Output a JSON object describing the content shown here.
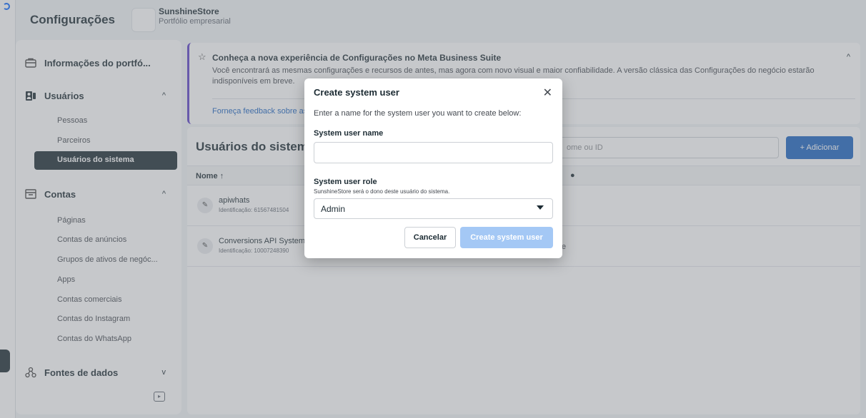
{
  "header": {
    "title": "Configurações",
    "store_name": "SunshineStore",
    "store_subtitle": "Portfólio empresarial"
  },
  "sidebar": {
    "sections": [
      {
        "label": "Informações do portfó...",
        "icon": "briefcase-icon"
      },
      {
        "label": "Usuários",
        "icon": "people-icon",
        "chevron": "^"
      },
      {
        "label": "Contas",
        "icon": "folder-icon",
        "chevron": "^"
      },
      {
        "label": "Fontes de dados",
        "icon": "data-sources-icon",
        "chevron": "v"
      }
    ],
    "user_items": [
      "Pessoas",
      "Parceiros",
      "Usuários do sistema"
    ],
    "account_items": [
      "Páginas",
      "Contas de anúncios",
      "Grupos de ativos de negóc...",
      "Apps",
      "Contas comerciais",
      "Contas do Instagram",
      "Contas do WhatsApp"
    ]
  },
  "banner": {
    "title": "Conheça a nova experiência de Configurações no Meta Business Suite",
    "text": "Você encontrará as mesmas configurações e recursos de antes, mas agora com novo visual e maior confiabilidade. A versão clássica das Configurações do negócio estarão indisponíveis em breve.",
    "link": "Forneça feedback sobre as"
  },
  "panel": {
    "title": "Usuários do sistema",
    "search_placeholder": "ome ou ID",
    "add_button": "+ Adicionar",
    "col_name": "Nome ↑",
    "rows": [
      {
        "name": "apiwhats",
        "id": "Identificação: 61567481504",
        "extra": ""
      },
      {
        "name": "Conversions API System",
        "id": "Identificação: 10007248390",
        "extra": "e"
      }
    ]
  },
  "modal": {
    "title": "Create system user",
    "intro": "Enter a name for the system user you want to create below:",
    "name_label": "System user name",
    "name_value": "",
    "role_label": "System user role",
    "role_help": "SunshineStore será o dono deste usuário do sistema.",
    "role_value": "Admin",
    "cancel": "Cancelar",
    "create": "Create system user"
  },
  "colors": {
    "accent": "#1d65c1",
    "active_nav": "#1c2b33",
    "banner_border": "#5c40c8",
    "disabled_button": "#a4c8f5"
  }
}
